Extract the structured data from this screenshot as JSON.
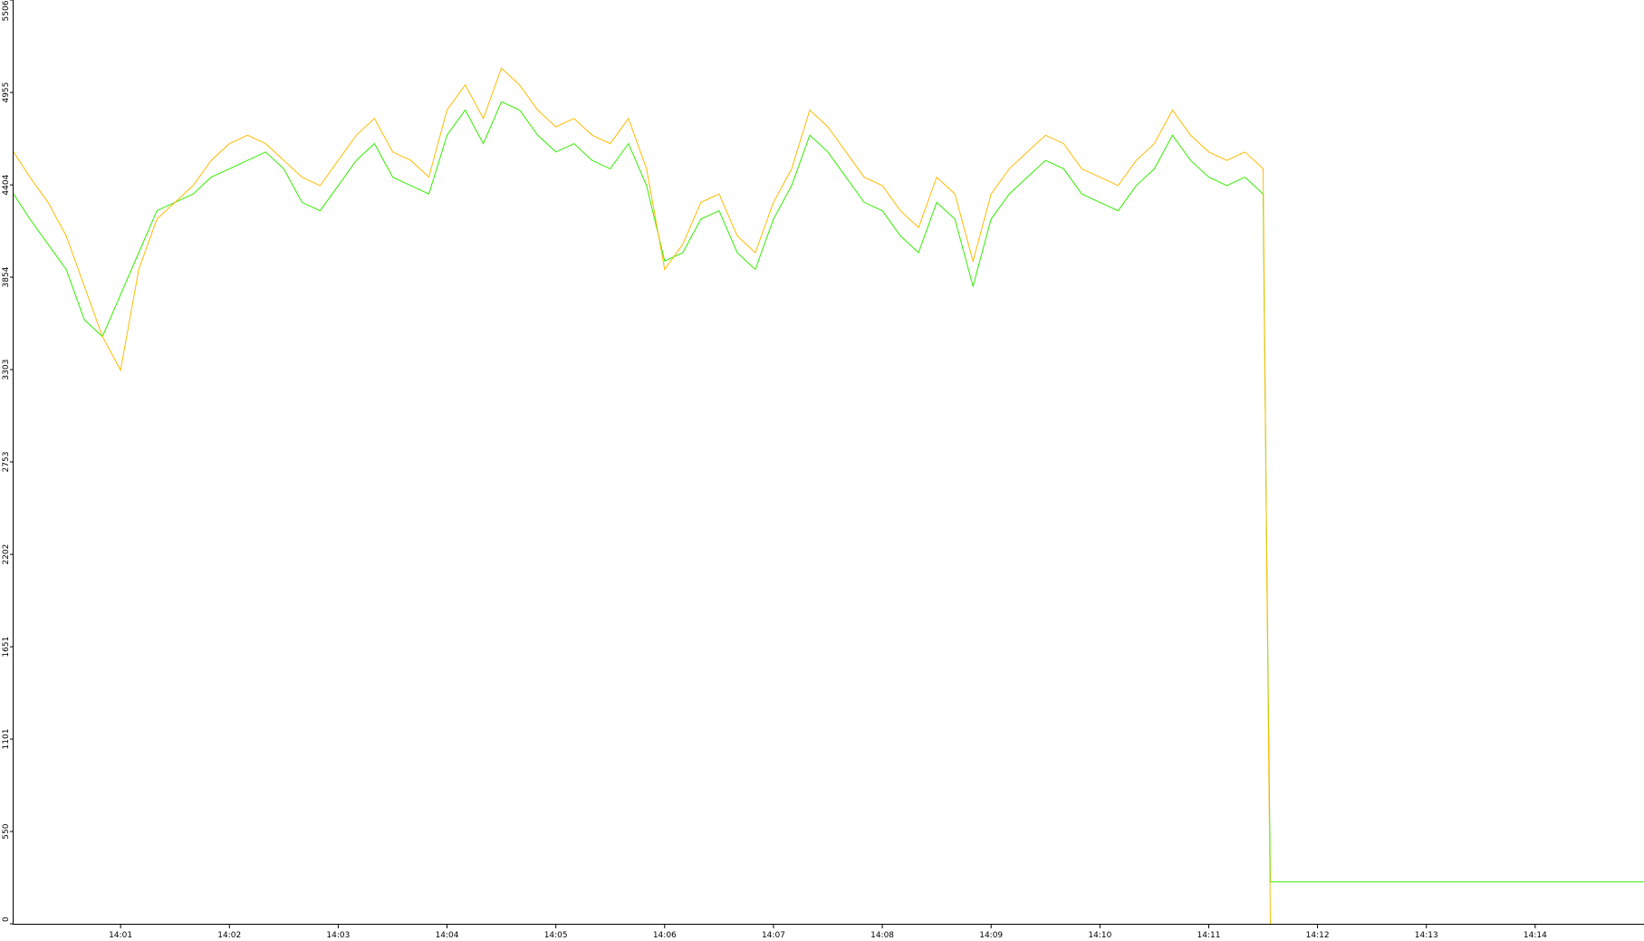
{
  "chart_data": {
    "type": "line",
    "title": "",
    "xlabel": "",
    "ylabel": "",
    "grid": false,
    "legend": "none",
    "ylim": [
      0,
      5506
    ],
    "y_ticks": [
      0,
      550,
      1101,
      1651,
      2202,
      2753,
      3303,
      3854,
      4404,
      4955,
      5506
    ],
    "xlim": [
      "14:00:01",
      "14:15:00"
    ],
    "x_ticks": [
      "14:01",
      "14:02",
      "14:03",
      "14:04",
      "14:05",
      "14:06",
      "14:07",
      "14:08",
      "14:09",
      "14:10",
      "14:11",
      "14:12",
      "14:13",
      "14:14"
    ],
    "colors": {
      "background": "#ffffff",
      "axis": "#000000"
    },
    "series": [
      {
        "color": "#33ee00",
        "points": [
          [
            "14:00:01",
            4350
          ],
          [
            "14:00:10",
            4200
          ],
          [
            "14:00:20",
            4050
          ],
          [
            "14:00:30",
            3900
          ],
          [
            "14:00:40",
            3600
          ],
          [
            "14:00:50",
            3500
          ],
          [
            "14:01:00",
            3750
          ],
          [
            "14:01:10",
            4000
          ],
          [
            "14:01:20",
            4250
          ],
          [
            "14:01:30",
            4300
          ],
          [
            "14:01:40",
            4350
          ],
          [
            "14:01:50",
            4450
          ],
          [
            "14:02:00",
            4500
          ],
          [
            "14:02:10",
            4550
          ],
          [
            "14:02:20",
            4600
          ],
          [
            "14:02:30",
            4500
          ],
          [
            "14:02:40",
            4300
          ],
          [
            "14:02:50",
            4250
          ],
          [
            "14:03:00",
            4400
          ],
          [
            "14:03:10",
            4550
          ],
          [
            "14:03:20",
            4650
          ],
          [
            "14:03:30",
            4450
          ],
          [
            "14:03:40",
            4400
          ],
          [
            "14:03:50",
            4350
          ],
          [
            "14:04:00",
            4700
          ],
          [
            "14:04:10",
            4850
          ],
          [
            "14:04:20",
            4650
          ],
          [
            "14:04:30",
            4900
          ],
          [
            "14:04:40",
            4850
          ],
          [
            "14:04:50",
            4700
          ],
          [
            "14:05:00",
            4600
          ],
          [
            "14:05:10",
            4650
          ],
          [
            "14:05:20",
            4550
          ],
          [
            "14:05:30",
            4500
          ],
          [
            "14:05:40",
            4650
          ],
          [
            "14:05:50",
            4400
          ],
          [
            "14:06:00",
            3950
          ],
          [
            "14:06:10",
            4000
          ],
          [
            "14:06:20",
            4200
          ],
          [
            "14:06:30",
            4250
          ],
          [
            "14:06:40",
            4000
          ],
          [
            "14:06:50",
            3900
          ],
          [
            "14:07:00",
            4200
          ],
          [
            "14:07:10",
            4400
          ],
          [
            "14:07:20",
            4700
          ],
          [
            "14:07:30",
            4600
          ],
          [
            "14:07:40",
            4450
          ],
          [
            "14:07:50",
            4300
          ],
          [
            "14:08:00",
            4250
          ],
          [
            "14:08:10",
            4100
          ],
          [
            "14:08:20",
            4000
          ],
          [
            "14:08:30",
            4300
          ],
          [
            "14:08:40",
            4200
          ],
          [
            "14:08:50",
            3800
          ],
          [
            "14:09:00",
            4200
          ],
          [
            "14:09:10",
            4350
          ],
          [
            "14:09:20",
            4450
          ],
          [
            "14:09:30",
            4550
          ],
          [
            "14:09:40",
            4500
          ],
          [
            "14:09:50",
            4350
          ],
          [
            "14:10:00",
            4300
          ],
          [
            "14:10:10",
            4250
          ],
          [
            "14:10:20",
            4400
          ],
          [
            "14:10:30",
            4500
          ],
          [
            "14:10:40",
            4700
          ],
          [
            "14:10:50",
            4550
          ],
          [
            "14:11:00",
            4450
          ],
          [
            "14:11:10",
            4400
          ],
          [
            "14:11:20",
            4450
          ],
          [
            "14:11:30",
            4350
          ],
          [
            "14:11:32",
            2200
          ],
          [
            "14:11:34",
            250
          ],
          [
            "14:15:00",
            250
          ]
        ]
      },
      {
        "color": "#ffbb00",
        "points": [
          [
            "14:00:01",
            4600
          ],
          [
            "14:00:10",
            4450
          ],
          [
            "14:00:20",
            4300
          ],
          [
            "14:00:30",
            4100
          ],
          [
            "14:00:40",
            3800
          ],
          [
            "14:00:50",
            3500
          ],
          [
            "14:01:00",
            3300
          ],
          [
            "14:01:10",
            3900
          ],
          [
            "14:01:20",
            4200
          ],
          [
            "14:01:30",
            4300
          ],
          [
            "14:01:40",
            4400
          ],
          [
            "14:01:50",
            4550
          ],
          [
            "14:02:00",
            4650
          ],
          [
            "14:02:10",
            4700
          ],
          [
            "14:02:20",
            4650
          ],
          [
            "14:02:30",
            4550
          ],
          [
            "14:02:40",
            4450
          ],
          [
            "14:02:50",
            4400
          ],
          [
            "14:03:00",
            4550
          ],
          [
            "14:03:10",
            4700
          ],
          [
            "14:03:20",
            4800
          ],
          [
            "14:03:30",
            4600
          ],
          [
            "14:03:40",
            4550
          ],
          [
            "14:03:50",
            4450
          ],
          [
            "14:04:00",
            4850
          ],
          [
            "14:04:10",
            5000
          ],
          [
            "14:04:20",
            4800
          ],
          [
            "14:04:30",
            5100
          ],
          [
            "14:04:40",
            5000
          ],
          [
            "14:04:50",
            4850
          ],
          [
            "14:05:00",
            4750
          ],
          [
            "14:05:10",
            4800
          ],
          [
            "14:05:20",
            4700
          ],
          [
            "14:05:30",
            4650
          ],
          [
            "14:05:40",
            4800
          ],
          [
            "14:05:50",
            4500
          ],
          [
            "14:06:00",
            3900
          ],
          [
            "14:06:10",
            4050
          ],
          [
            "14:06:20",
            4300
          ],
          [
            "14:06:30",
            4350
          ],
          [
            "14:06:40",
            4100
          ],
          [
            "14:06:50",
            4000
          ],
          [
            "14:07:00",
            4300
          ],
          [
            "14:07:10",
            4500
          ],
          [
            "14:07:20",
            4850
          ],
          [
            "14:07:30",
            4750
          ],
          [
            "14:07:40",
            4600
          ],
          [
            "14:07:50",
            4450
          ],
          [
            "14:08:00",
            4400
          ],
          [
            "14:08:10",
            4250
          ],
          [
            "14:08:20",
            4150
          ],
          [
            "14:08:30",
            4450
          ],
          [
            "14:08:40",
            4350
          ],
          [
            "14:08:50",
            3950
          ],
          [
            "14:09:00",
            4350
          ],
          [
            "14:09:10",
            4500
          ],
          [
            "14:09:20",
            4600
          ],
          [
            "14:09:30",
            4700
          ],
          [
            "14:09:40",
            4650
          ],
          [
            "14:09:50",
            4500
          ],
          [
            "14:10:00",
            4450
          ],
          [
            "14:10:10",
            4400
          ],
          [
            "14:10:20",
            4550
          ],
          [
            "14:10:30",
            4650
          ],
          [
            "14:10:40",
            4850
          ],
          [
            "14:10:50",
            4700
          ],
          [
            "14:11:00",
            4600
          ],
          [
            "14:11:10",
            4550
          ],
          [
            "14:11:20",
            4600
          ],
          [
            "14:11:30",
            4500
          ],
          [
            "14:11:32",
            2150
          ],
          [
            "14:11:34",
            0
          ]
        ]
      }
    ]
  }
}
